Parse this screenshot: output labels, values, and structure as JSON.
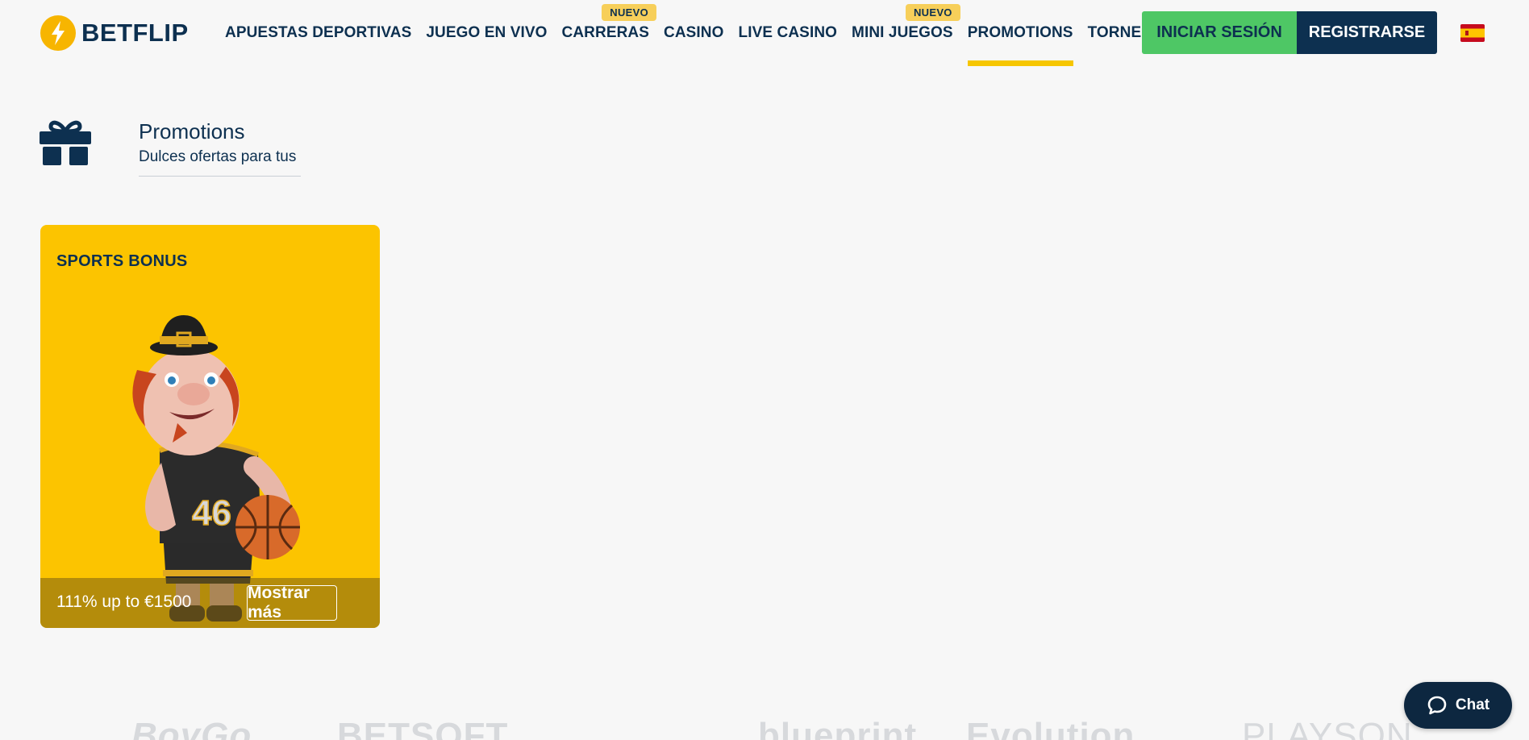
{
  "header": {
    "logo_text": "BETFLIP",
    "nav": [
      {
        "label": "APUESTAS DEPORTIVAS"
      },
      {
        "label": "JUEGO EN VIVO"
      },
      {
        "label": "CARRERAS",
        "badge": "NUEVO"
      },
      {
        "label": "CASINO"
      },
      {
        "label": "LIVE CASINO"
      },
      {
        "label": "MINI JUEGOS",
        "badge": "NUEVO"
      },
      {
        "label": "PROMOTIONS",
        "active": true
      },
      {
        "label": "TORNEOS"
      }
    ],
    "login_label": "INICIAR SESIÓN",
    "register_label": "REGISTRARSE",
    "language_icon": "spain-flag-icon"
  },
  "page": {
    "icon": "gift-icon",
    "title": "Promotions",
    "subtitle": "Dulces ofertas para tus"
  },
  "promos": [
    {
      "title": "SPORTS BONUS",
      "offer": "111% up to €1500",
      "more_label": "Mostrar más",
      "jersey_number": "46"
    }
  ],
  "providers": [
    "BoyGo",
    "BETSOFT",
    "blueprint",
    "Evolution",
    "PLAYSON"
  ],
  "chat": {
    "label": "Chat",
    "icon": "chat-bubble-icon"
  },
  "colors": {
    "brand_navy": "#0d3050",
    "accent_yellow": "#fcc400",
    "login_green": "#4ec765",
    "background": "#f7f7f7"
  }
}
